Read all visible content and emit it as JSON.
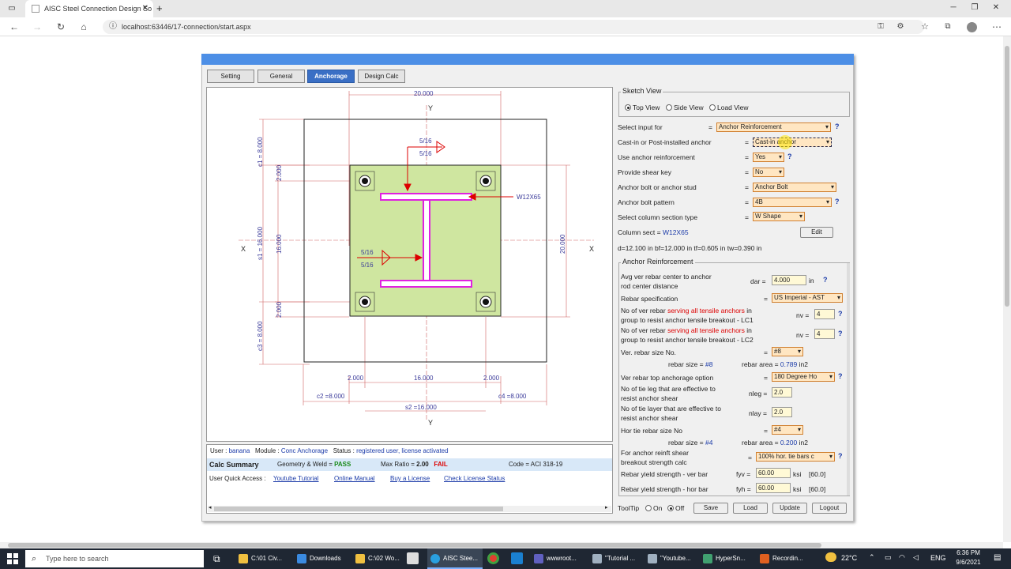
{
  "browser": {
    "tab_title": "AISC Steel Connection Design So",
    "url": "localhost:63446/17-connection/start.aspx"
  },
  "tabs": [
    "Setting",
    "General",
    "Anchorage",
    "Design Calc"
  ],
  "active_tab": "Anchorage",
  "sketch": {
    "dims_top": "20.000",
    "dims_right": "20.000",
    "y_label": "Y",
    "x_label": "X",
    "c1": "c1 = 8.000",
    "c3": "c3 = 8.000",
    "s1": "s1 = 16.000",
    "c2": "c2 =8.000",
    "c4": "c4 =8.000",
    "s2": "s2 =16.000",
    "d2000": "2.000",
    "d16000": "16.000",
    "d16000v": "16.000",
    "weld_top_a": "5/16",
    "weld_top_b": "5/16",
    "weld_mid_a": "5/16",
    "weld_mid_b": "5/16",
    "section": "W12X65"
  },
  "info": {
    "user_label": "User :",
    "user": "banana",
    "module_label": "Module :",
    "module": "Conc Anchorage",
    "status_label": "Status :",
    "status": "registered user, license activated",
    "calc_summary": "Calc Summary",
    "geom_label": "Geometry & Weld =",
    "geom_value": "PASS",
    "ratio_label": "Max Ratio =",
    "ratio_value": "2.00",
    "ratio_status": "FAIL",
    "code": "Code = ACI 318-19",
    "quick_access": "User Quick Access :",
    "links": [
      "Youtube Tutorial",
      "Online Manual",
      "Buy a License",
      "Check License Status"
    ]
  },
  "form": {
    "sketch_view": "Sketch View",
    "views": [
      "Top View",
      "Side View",
      "Load View"
    ],
    "select_input_label": "Select input for",
    "select_input": "Anchor Reinforcement",
    "cast_label": "Cast-in or Post-installed anchor",
    "cast": "Cast-in anchor",
    "use_reinf_label": "Use anchor reinforcement",
    "use_reinf": "Yes",
    "shear_key_label": "Provide shear key",
    "shear_key": "No",
    "bolt_label": "Anchor bolt or anchor stud",
    "bolt": "Anchor Bolt",
    "pattern_label": "Anchor bolt pattern",
    "pattern": "4B",
    "col_type_label": "Select column section type",
    "col_type": "W Shape",
    "col_sect_label": "Column sect =",
    "col_sect": "W12X65",
    "edit": "Edit",
    "dims": "d=12.100 in  bf=12.000 in  tf=0.605 in  tw=0.390 in",
    "anchor_reinf": "Anchor Reinforcement",
    "avg_label_1": "Avg ver rebar center to anchor",
    "avg_label_2": "rod center distance",
    "dar_sym": "dar =",
    "dar": "4.000",
    "unit_in": "in",
    "rebar_spec_label": "Rebar specification",
    "rebar_spec": "US Imperial - AST",
    "nv1_label_1": "No of ver rebar",
    "nv1_label_red": "serving all tensile anchors",
    "nv1_label_2": "in",
    "nv1_label_3": "group to resist anchor tensile breakout - LC1",
    "nv_sym": "nv =",
    "nv1": "4",
    "nv2_label_3": "group to resist anchor tensile breakout - LC2",
    "nv2": "4",
    "ver_size_label": "Ver. rebar size No.",
    "ver_size": "#8",
    "rebar_size_label": "rebar size =",
    "ver_size_txt": "#8",
    "rebar_area_label": "rebar area =",
    "ver_area": "0.789",
    "unit_in2": "in2",
    "anch_opt_label": "Ver rebar top anchorage option",
    "anch_opt": "180 Degree Ho",
    "nleg_label_1": "No of tie leg that are effective to",
    "nleg_label_2": "resist anchor shear",
    "nleg_sym": "nleg =",
    "nleg": "2.0",
    "nlay_label_1": "No of tie layer that are effective to",
    "nlay_label_2": "resist anchor shear",
    "nlay_sym": "nlay =",
    "nlay": "2.0",
    "hor_size_label": "Hor tie rebar size No",
    "hor_size": "#4",
    "hor_size_txt": "#4",
    "hor_area": "0.200",
    "shear_label_1": "For anchor reinft shear",
    "shear_label_2": "breakout strength calc",
    "shear_opt": "100% hor. tie bars c",
    "fyv_label": "Rebar yield strength - ver bar",
    "fyv_sym": "fyv =",
    "fyv": "60.00",
    "fyh_label": "Rebar yield strength - hor bar",
    "fyh_sym": "fyh =",
    "fyh": "60.00",
    "unit_ksi": "ksi",
    "fy_ref": "[60.0]",
    "tooltip": "ToolTip",
    "on": "On",
    "off": "Off",
    "save": "Save",
    "load": "Load",
    "update": "Update",
    "logout": "Logout"
  },
  "taskbar": {
    "search": "Type here to search",
    "items": [
      "C:\\01 Civ...",
      "Downloads",
      "C:\\02 Wo...",
      "AISC Stee...",
      "wwwroot...",
      "\"Tutorial ...",
      "\"Youtube...",
      "HyperSn...",
      "Recordin..."
    ],
    "temp": "22°C",
    "lang": "ENG",
    "time": "6:36 PM",
    "date": "9/6/2021"
  },
  "colors": {
    "accent": "#4d8fe6",
    "plate": "#cfe6a0",
    "column": "#e020e0",
    "dim": "#c04040"
  }
}
